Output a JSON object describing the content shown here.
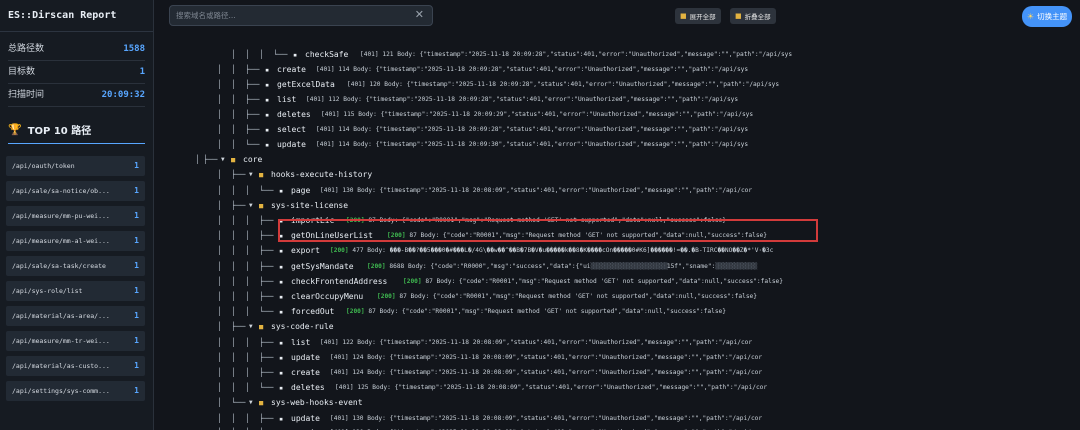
{
  "sidebar": {
    "title": "ES::Dirscan Report",
    "stats": [
      {
        "label": "总路径数",
        "value": "1588"
      },
      {
        "label": "目标数",
        "value": "1"
      },
      {
        "label": "扫描时间",
        "value": "20:09:32"
      }
    ],
    "top10_title": "TOP 10 路径",
    "top10": [
      {
        "path": "/api/oauth/token",
        "count": "1"
      },
      {
        "path": "/api/sale/sa-notice/ob...",
        "count": "1"
      },
      {
        "path": "/api/measure/mm-pu-wei...",
        "count": "1"
      },
      {
        "path": "/api/measure/mm-al-wei...",
        "count": "1"
      },
      {
        "path": "/api/sale/sa-task/create",
        "count": "1"
      },
      {
        "path": "/api/sys-role/list",
        "count": "1"
      },
      {
        "path": "/api/material/as-area/...",
        "count": "1"
      },
      {
        "path": "/api/measure/mm-tr-wei...",
        "count": "1"
      },
      {
        "path": "/api/material/as-custo...",
        "count": "1"
      },
      {
        "path": "/api/settings/sys-comm...",
        "count": "1"
      }
    ]
  },
  "toolbar": {
    "search_placeholder": "搜索域名或路径...",
    "expand_all": "展开全部",
    "collapse_all": "折叠全部",
    "theme": "切换主题"
  },
  "tree_rows": [
    {
      "name": "checkSafe",
      "meta": "[401] 121 Body: {\"timestamp\":\"2025-11-18 20:09:28\",\"status\":401,\"error\":\"Unauthorized\",\"message\":\"\",\"path\":\"/api/sys"
    },
    {
      "name": "create",
      "meta": "[401] 114 Body: {\"timestamp\":\"2025-11-18 20:09:28\",\"status\":401,\"error\":\"Unauthorized\",\"message\":\"\",\"path\":\"/api/sys"
    },
    {
      "name": "getExcelData",
      "meta": "[401] 120 Body: {\"timestamp\":\"2025-11-18 20:09:28\",\"status\":401,\"error\":\"Unauthorized\",\"message\":\"\",\"path\":\"/api/sys"
    },
    {
      "name": "list",
      "meta": "[401] 112 Body: {\"timestamp\":\"2025-11-18 20:09:28\",\"status\":401,\"error\":\"Unauthorized\",\"message\":\"\",\"path\":\"/api/sys"
    },
    {
      "name": "deletes",
      "meta": "[401] 115 Body: {\"timestamp\":\"2025-11-18 20:09:29\",\"status\":401,\"error\":\"Unauthorized\",\"message\":\"\",\"path\":\"/api/sys"
    },
    {
      "name": "select",
      "meta": "[401] 114 Body: {\"timestamp\":\"2025-11-18 20:09:28\",\"status\":401,\"error\":\"Unauthorized\",\"message\":\"\",\"path\":\"/api/sys"
    },
    {
      "name": "update",
      "meta": "[401] 114 Body: {\"timestamp\":\"2025-11-18 20:09:30\",\"status\":401,\"error\":\"Unauthorized\",\"message\":\"\",\"path\":\"/api/sys"
    },
    {
      "name": "core",
      "meta": ""
    },
    {
      "name": "hooks-execute-history",
      "meta": ""
    },
    {
      "name": "page",
      "meta": "[401] 130 Body: {\"timestamp\":\"2025-11-18 20:08:09\",\"status\":401,\"error\":\"Unauthorized\",\"message\":\"\",\"path\":\"/api/cor"
    },
    {
      "name": "sys-site-license",
      "meta": ""
    },
    {
      "name": "importLic",
      "status": "[200]",
      "meta": "87 Body: {\"code\":\"R0001\",\"msg\":\"Request method 'GET' not supported\",\"data\":null,\"success\":false}"
    },
    {
      "name": "getOnLineUserList",
      "status": "[200]",
      "meta": "87 Body: {\"code\":\"R0001\",\"msg\":\"Request method 'GET' not supported\",\"data\":null,\"success\":false}"
    },
    {
      "name": "export",
      "status": "[200]",
      "meta": "477 Body: ���-B��?��5���0�#���L�/4G\\��w��^��B�7B�V�u�����k��8�K����cOn�����0#K6]������!=��.�B-TIRC��NO��Z�*'V·�3c"
    },
    {
      "name": "getSysMandate",
      "status": "[200]",
      "meta": "8688 Body: {\"code\":\"R0000\",\"msg\":\"success\",\"data\":{\"ui",
      "meta2": "15f\",\"sname\":"
    },
    {
      "name": "checkFrontendAddress",
      "status": "[200]",
      "meta": "87 Body: {\"code\":\"R0001\",\"msg\":\"Request method 'GET' not supported\",\"data\":null,\"success\":false}"
    },
    {
      "name": "clearOccupyMenu",
      "status": "[200]",
      "meta": "87 Body: {\"code\":\"R0001\",\"msg\":\"Request method 'GET' not supported\",\"data\":null,\"success\":false}"
    },
    {
      "name": "forcedOut",
      "status": "[200]",
      "meta": "87 Body: {\"code\":\"R0001\",\"msg\":\"Request method 'GET' not supported\",\"data\":null,\"success\":false}"
    },
    {
      "name": "sys-code-rule",
      "meta": ""
    },
    {
      "name": "list",
      "meta": "[401] 122 Body: {\"timestamp\":\"2025-11-18 20:08:09\",\"status\":401,\"error\":\"Unauthorized\",\"message\":\"\",\"path\":\"/api/cor"
    },
    {
      "name": "update",
      "meta": "[401] 124 Body: {\"timestamp\":\"2025-11-18 20:08:09\",\"status\":401,\"error\":\"Unauthorized\",\"message\":\"\",\"path\":\"/api/cor"
    },
    {
      "name": "create",
      "meta": "[401] 124 Body: {\"timestamp\":\"2025-11-18 20:08:09\",\"status\":401,\"error\":\"Unauthorized\",\"message\":\"\",\"path\":\"/api/cor"
    },
    {
      "name": "deletes",
      "meta": "[401] 125 Body: {\"timestamp\":\"2025-11-18 20:08:09\",\"status\":401,\"error\":\"Unauthorized\",\"message\":\"\",\"path\":\"/api/cor"
    },
    {
      "name": "sys-web-hooks-event",
      "meta": ""
    },
    {
      "name": "update",
      "meta": "[401] 130 Body: {\"timestamp\":\"2025-11-18 20:08:09\",\"status\":401,\"error\":\"Unauthorized\",\"message\":\"\",\"path\":\"/api/cor"
    },
    {
      "name": "create",
      "meta": "[401] 130 Body: {\"timestamp\":\"2025-11-18 20:08:09\",\"status\":401,\"error\":\"Unauthorized\",\"message\":\"\",\"path\":\"/api/cor"
    }
  ]
}
